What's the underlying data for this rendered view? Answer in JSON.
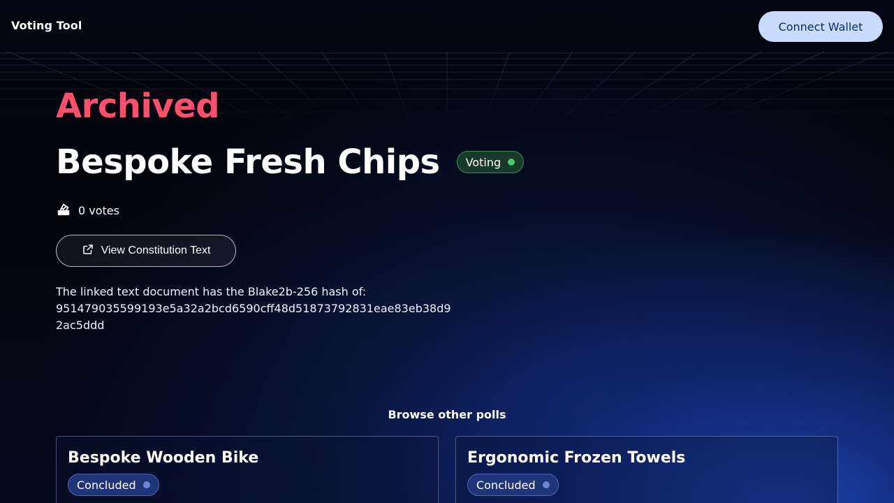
{
  "header": {
    "brand": "Voting Tool",
    "connect_label": "Connect Wallet"
  },
  "poll": {
    "status_heading": "Archived",
    "title": "Bespoke Fresh Chips",
    "badge": {
      "label": "Voting",
      "color": "#4cc46a"
    },
    "votes_text": "0 votes",
    "view_button_label": "View Constitution Text",
    "hash_intro": "The linked text document has the Blake2b-256 hash of:",
    "hash_value": "951479035599193e5a32a2bcd6590cff48d51873792831eae83eb38d92ac5ddd"
  },
  "browse": {
    "heading": "Browse other polls",
    "cards": [
      {
        "title": "Bespoke Wooden Bike",
        "badge_label": "Concluded"
      },
      {
        "title": "Ergonomic Frozen Towels",
        "badge_label": "Concluded"
      }
    ]
  },
  "colors": {
    "accent_archived": "#ff4f6e",
    "connect_button_bg": "#c9dcff",
    "concluded_badge_bg": "#1f3578"
  }
}
